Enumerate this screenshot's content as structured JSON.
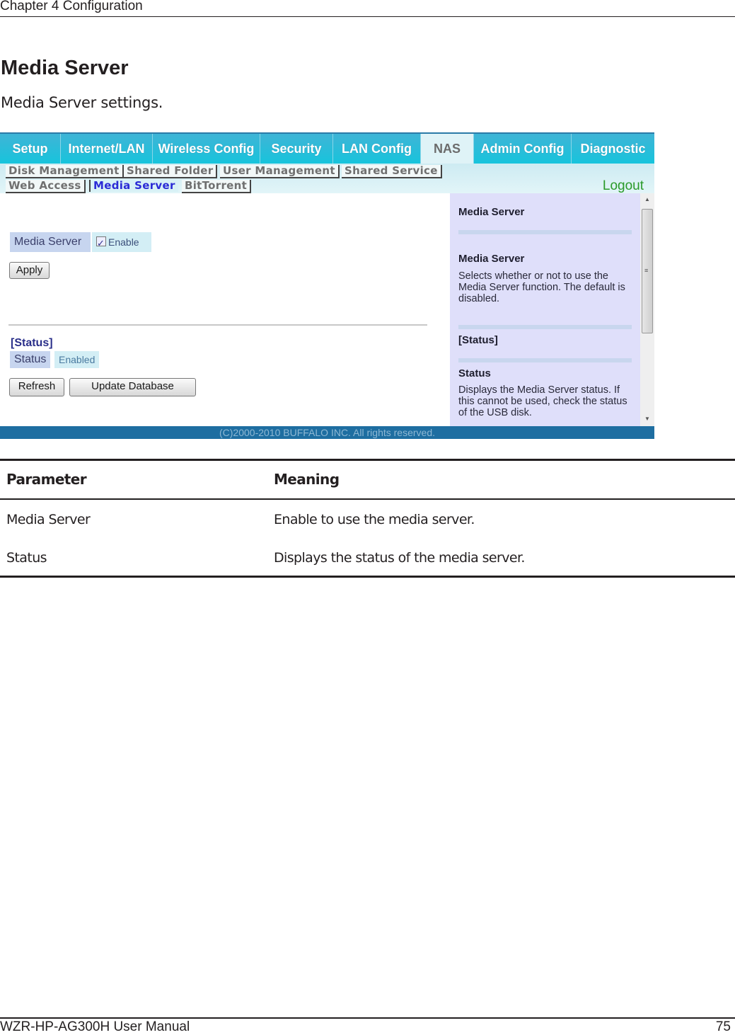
{
  "header": {
    "chapter": "Chapter 4  Configuration"
  },
  "section": {
    "title": "Media Server",
    "subtitle": "Media Server settings."
  },
  "screenshot": {
    "top_tabs": [
      {
        "label": "Setup",
        "active": false
      },
      {
        "label": "Internet/LAN",
        "active": false
      },
      {
        "label": "Wireless Config",
        "active": false
      },
      {
        "label": "Security",
        "active": false
      },
      {
        "label": "LAN Config",
        "active": false
      },
      {
        "label": "NAS",
        "active": true
      },
      {
        "label": "Admin Config",
        "active": false
      },
      {
        "label": "Diagnostic",
        "active": false
      }
    ],
    "sub_tabs_row1": [
      {
        "label": "Disk Management"
      },
      {
        "label": "Shared Folder"
      },
      {
        "label": "User Management"
      },
      {
        "label": "Shared Service"
      }
    ],
    "sub_tabs_row2": [
      {
        "label": "Web Access",
        "active": false
      },
      {
        "label": "Media Server",
        "active": true
      },
      {
        "label": "BitTorrent",
        "active": false
      }
    ],
    "logout": "Logout",
    "form": {
      "media_server_label": "Media Server",
      "enable_label": "Enable",
      "enable_checked": true,
      "apply_button": "Apply",
      "status_heading": "[Status]",
      "status_label": "Status",
      "status_value": "Enabled",
      "refresh_button": "Refresh",
      "update_db_button": "Update Database"
    },
    "help": {
      "title": "Media Server",
      "item1_title": "Media Server",
      "item1_text": "Selects whether or not to use the Media Server function. The default is disabled.",
      "status_heading": "[Status]",
      "item2_title": "Status",
      "item2_text": "Displays the Media Server status. If this cannot be used, check the status of the USB disk."
    },
    "copyright": "(C)2000-2010 BUFFALO INC. All rights reserved."
  },
  "table": {
    "headers": [
      "Parameter",
      "Meaning"
    ],
    "rows": [
      [
        "Media Server",
        "Enable to use the media server."
      ],
      [
        "Status",
        "Displays the status of the media server."
      ]
    ]
  },
  "footer": {
    "manual": "WZR-HP-AG300H User Manual",
    "page": "75"
  }
}
